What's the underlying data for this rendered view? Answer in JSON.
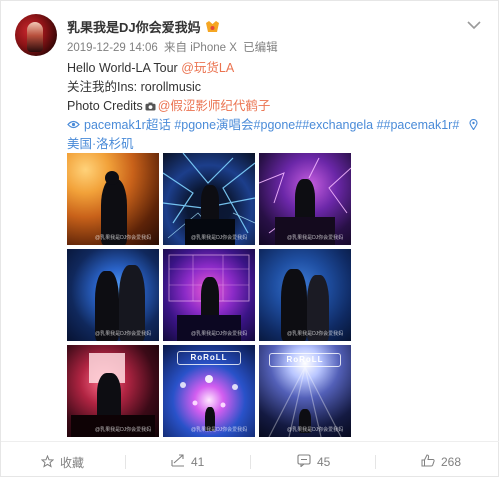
{
  "post": {
    "username": "乳果我是DJ你会爱我妈",
    "meta": {
      "date": "2019-12-29 14:06",
      "source": "来自 iPhone X",
      "edited": "已编辑"
    },
    "text": {
      "line1_prefix": "Hello World-LA Tour ",
      "line1_mention": "@玩货LA",
      "line2": "关注我的Ins: rorollmusic",
      "line3_prefix": "Photo Credits",
      "line3_mention": "@假涩影师纪代鹤子",
      "line4_topic1": "pacemak1r超话",
      "line4_topic2": "#pgone演唱会#",
      "line4_topic3": "pgone##exchangela ##pacemak1r#",
      "line5_location": "美国·洛杉矶"
    },
    "images": [
      {
        "watermark": "@乳果我是DJ你会爱我妈"
      },
      {
        "watermark": "@乳果我是DJ你会爱我妈"
      },
      {
        "watermark": "@乳果我是DJ你会爱我妈"
      },
      {
        "watermark": "@乳果我是DJ你会爱我妈"
      },
      {
        "watermark": "@乳果我是DJ你会爱我妈"
      },
      {
        "watermark": "@乳果我是DJ你会爱我妈"
      },
      {
        "watermark": "@乳果我是DJ你会爱我妈"
      },
      {
        "watermark": "@乳果我是DJ你会爱我妈"
      },
      {
        "watermark": "@乳果我是DJ你会爱我妈"
      }
    ],
    "logo_text": "RoRoLL"
  },
  "footer": {
    "favorite_label": "收藏",
    "repost_count": "41",
    "comment_count": "45",
    "like_count": "268"
  },
  "colors": {
    "accent": "#eb7350",
    "link_blue": "#4a8bd8",
    "meta_gray": "#808080"
  }
}
